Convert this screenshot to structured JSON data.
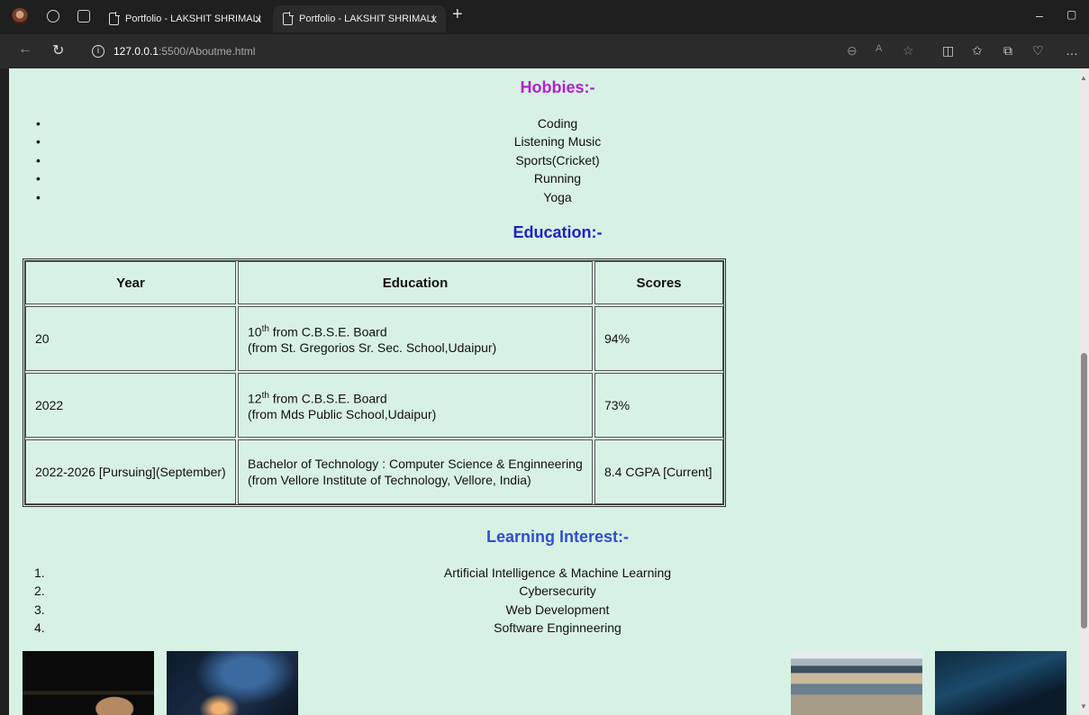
{
  "browser": {
    "tabs": [
      {
        "title": "Portfolio - LAKSHIT SHRIMALI",
        "close": "x"
      },
      {
        "title": "Portfolio - LAKSHIT SHRIMALI",
        "close": "x"
      }
    ],
    "new_tab": "+",
    "url_host": "127.0.0.1",
    "url_path": ":5500/Aboutme.html"
  },
  "hobbies": {
    "heading": "Hobbies:-",
    "heading_color": "#b41fd3",
    "bullet": "•",
    "items": [
      "Coding",
      "Listening Music",
      "Sports(Cricket)",
      "Running",
      "Yoga"
    ]
  },
  "education": {
    "heading": "Education:-",
    "heading_color": "#1c23c4",
    "headers": [
      "Year",
      "Education",
      "Scores"
    ],
    "rows": [
      {
        "year": "20",
        "level": "10",
        "sup": "th",
        "board": " from C.B.S.E. Board",
        "school": "(from St. Gregorios Sr. Sec. School,Udaipur)",
        "score": "94%"
      },
      {
        "year": "2022",
        "level": "12",
        "sup": "th",
        "board": " from C.B.S.E. Board",
        "school": "(from Mds Public School,Udaipur)",
        "score": "73%"
      },
      {
        "year": "2022-2026 [Pursuing](September)",
        "level": "",
        "sup": "",
        "board": "Bachelor of Technology : Computer Science & Enginneering",
        "school": "(from Vellore Institute of Technology, Vellore, India)",
        "score": "8.4 CGPA [Current]"
      }
    ]
  },
  "learning": {
    "heading": "Learning Interest:-",
    "heading_color": "#2f4fcf",
    "items": [
      {
        "num": "1.",
        "text": "Artificial Intelligence & Machine Learning"
      },
      {
        "num": "2.",
        "text": "Cybersecurity"
      },
      {
        "num": "3.",
        "text": "Web Development"
      },
      {
        "num": "4.",
        "text": "Software Enginneering"
      }
    ]
  }
}
